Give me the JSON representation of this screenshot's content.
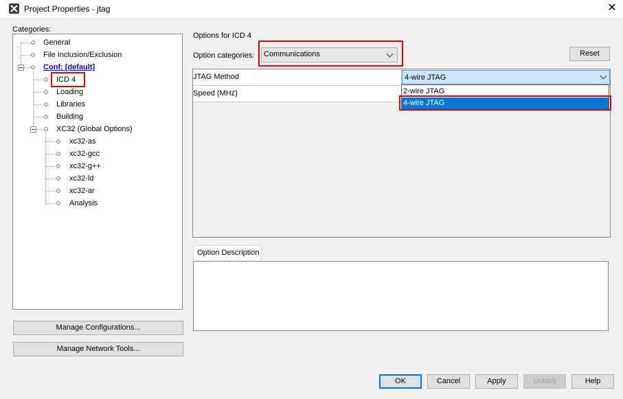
{
  "window": {
    "title": "Project Properties - jtag",
    "close_icon": "close-icon",
    "app_icon": "mplab-x-icon"
  },
  "categories": {
    "label": "Categories:",
    "items": [
      {
        "label": "General"
      },
      {
        "label": "File Inclusion/Exclusion"
      },
      {
        "label": "Conf: [default]"
      },
      {
        "label": "ICD 4"
      },
      {
        "label": "Loading"
      },
      {
        "label": "Libraries"
      },
      {
        "label": "Building"
      },
      {
        "label": "XC32 (Global Options)"
      },
      {
        "label": "xc32-as"
      },
      {
        "label": "xc32-gcc"
      },
      {
        "label": "xc32-g++"
      },
      {
        "label": "xc32-ld"
      },
      {
        "label": "xc32-ar"
      },
      {
        "label": "Analysis"
      }
    ],
    "manage_configs": "Manage Configurations...",
    "manage_network": "Manage Network Tools..."
  },
  "options": {
    "header": "Options for ICD 4",
    "category_label": "Option categories:",
    "category_value": "Communications",
    "reset": "Reset",
    "rows": [
      {
        "name": "JTAG Method",
        "value": "4-wire JTAG"
      },
      {
        "name": "Speed (MHz)",
        "value": ""
      }
    ],
    "dropdown_options": [
      "2-wire JTAG",
      "4-wire JTAG"
    ],
    "dropdown_selected": "4-wire JTAG",
    "description_tab": "Option Description"
  },
  "buttons": {
    "ok": "OK",
    "cancel": "Cancel",
    "apply": "Apply",
    "unlock": "Unlock",
    "help": "Help"
  },
  "colors": {
    "highlight": "#e60000",
    "selection": "#0078d7",
    "link": "#0000ff"
  }
}
